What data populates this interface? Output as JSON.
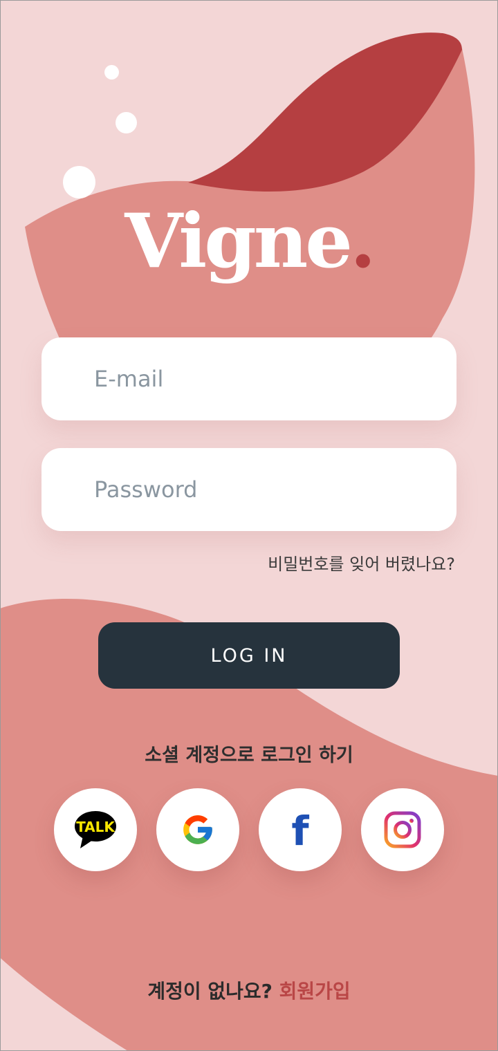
{
  "logo": {
    "text": "Vigne",
    "dot": "."
  },
  "login_form": {
    "email_placeholder": "E-mail",
    "password_placeholder": "Password",
    "forgot_password": "비밀번호를 잊어 버렸나요?",
    "login_button": "LOG IN"
  },
  "social": {
    "title": "소셜 계정으로 로그인 하기",
    "providers": [
      {
        "name": "kakao",
        "icon": "kakaotalk-icon",
        "label": "TALK"
      },
      {
        "name": "google",
        "icon": "google-icon"
      },
      {
        "name": "facebook",
        "icon": "facebook-icon",
        "label": "f"
      },
      {
        "name": "instagram",
        "icon": "instagram-icon"
      }
    ]
  },
  "signup": {
    "prompt": "계정이 없나요?",
    "link": "회원가입"
  },
  "colors": {
    "background": "#f3d6d6",
    "blob_light": "#df8e88",
    "blob_dark": "#b53f41",
    "button": "#26333d",
    "accent": "#b94646"
  }
}
